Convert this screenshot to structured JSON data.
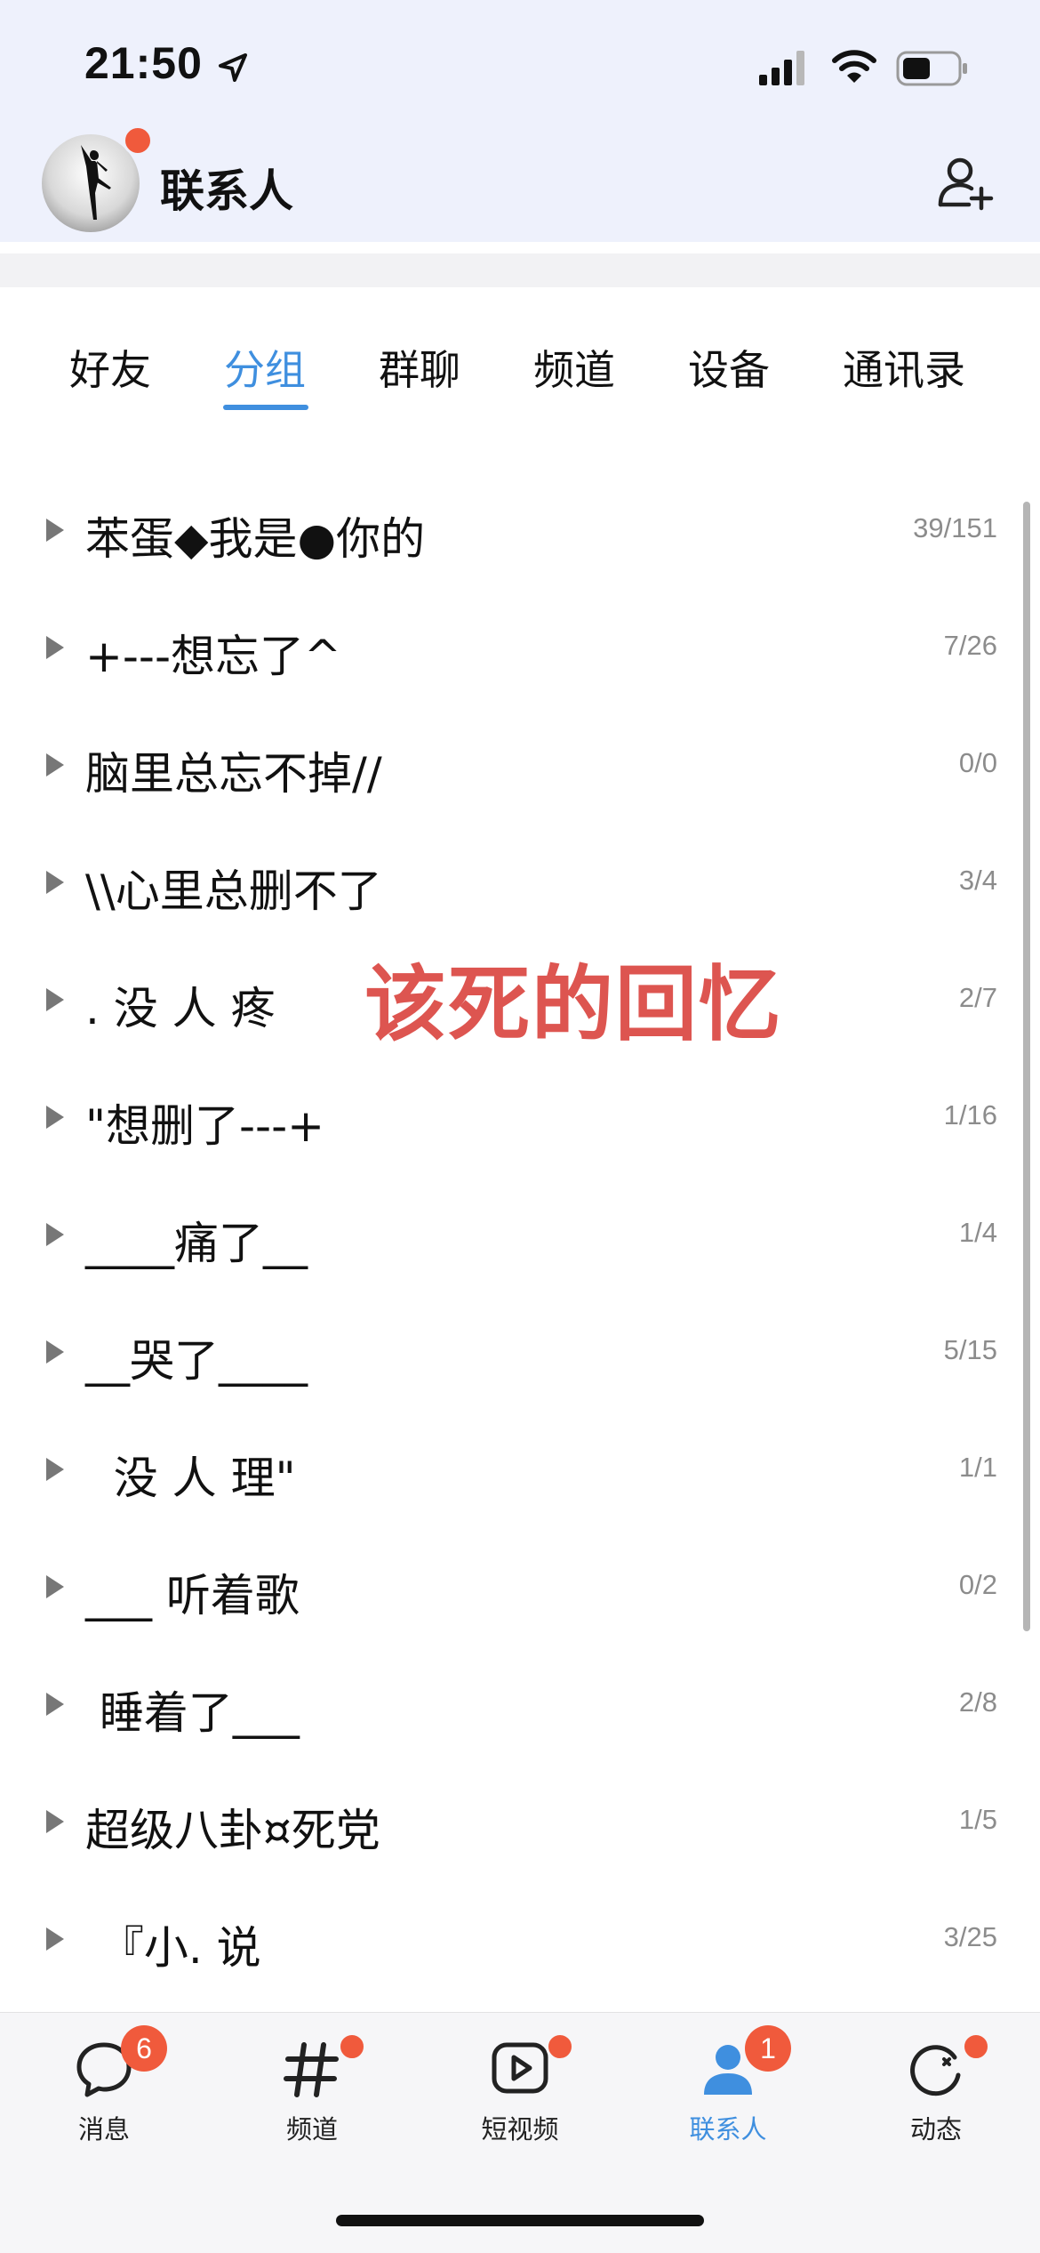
{
  "status_bar": {
    "time": "21:50"
  },
  "header": {
    "title": "联系人"
  },
  "tabs": [
    {
      "label": "好友"
    },
    {
      "label": "分组"
    },
    {
      "label": "群聊"
    },
    {
      "label": "频道"
    },
    {
      "label": "设备"
    },
    {
      "label": "通讯录"
    }
  ],
  "active_tab": "分组",
  "groups": [
    {
      "name": "苯蛋◆我是●你的",
      "count": "39/151"
    },
    {
      "name": "+---想忘了^",
      "count": "7/26"
    },
    {
      "name": "脑里总忘不掉//",
      "count": "0/0"
    },
    {
      "name": "\\\\心里总删不了",
      "count": "3/4"
    },
    {
      "name": ". 没 人 疼",
      "count": "2/7"
    },
    {
      "name": "\"想删了---+",
      "count": "1/16"
    },
    {
      "name": "____痛了__",
      "count": "1/4"
    },
    {
      "name": "__哭了____",
      "count": "5/15"
    },
    {
      "name": "  没 人 理\"",
      "count": "1/1"
    },
    {
      "name": "___ 听着歌",
      "count": "0/2"
    },
    {
      "name": " 睡着了___",
      "count": "2/8"
    },
    {
      "name": "超级八卦¤死党",
      "count": "1/5"
    },
    {
      "name": " 『小. 说",
      "count": "3/25"
    }
  ],
  "overlay_caption": "该死的回忆",
  "bottom_nav": [
    {
      "label": "消息",
      "icon": "chat-bubble-icon",
      "badge": "6"
    },
    {
      "label": "频道",
      "icon": "hash-icon",
      "badge": ""
    },
    {
      "label": "短视频",
      "icon": "video-play-icon",
      "badge": ""
    },
    {
      "label": "联系人",
      "icon": "contact-person-icon",
      "badge": "1"
    },
    {
      "label": "动态",
      "icon": "star-orbit-icon",
      "badge": ""
    }
  ],
  "colors": {
    "accent": "#3f8fdf",
    "badge": "#f05a3c",
    "caption": "#dd5550",
    "header_bg": "#eef1fc"
  }
}
